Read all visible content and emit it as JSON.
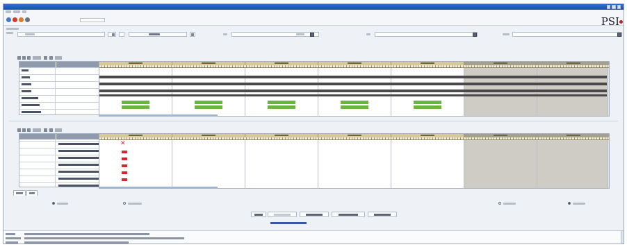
{
  "window": {
    "title": "",
    "accent": "#2f6fd6"
  },
  "menu": {
    "items": [
      "",
      "",
      ""
    ]
  },
  "toolbar": {
    "icons": [
      "save-icon",
      "stop-icon",
      "refresh-icon",
      "settings-icon"
    ],
    "selector_value": "",
    "logo_text": "PSI",
    "logo_dot_color": "#c8201e"
  },
  "filters": {
    "section_label": "",
    "field1_label": "",
    "field1_value": "",
    "field2_value": "",
    "field3_label": "",
    "field3_value": "",
    "field4_label": "",
    "field4_value": "",
    "field5_label": "",
    "field5_value": ""
  },
  "upper_grid": {
    "toolbar_count": "",
    "headers": [
      "",
      ""
    ],
    "rows": [
      "",
      "",
      "",
      "",
      "",
      "",
      ""
    ],
    "days": [
      "",
      "",
      "",
      "",
      "",
      "",
      ""
    ],
    "weekend_days": [
      5,
      6
    ],
    "bar_color_green": "#6db33f",
    "band_color": "#4a4848"
  },
  "lower_grid": {
    "toolbar_count": "",
    "headers": [
      "",
      ""
    ],
    "rows": [
      "",
      "",
      "",
      "",
      "",
      "",
      ""
    ],
    "days": [
      "",
      "",
      "",
      "",
      "",
      "",
      ""
    ],
    "marker_color": "#d8262a"
  },
  "tabs": [
    "",
    ""
  ],
  "options": {
    "left_radio": "",
    "mid_radio": "",
    "right_radio_1": "",
    "right_radio_2": ""
  },
  "actions": {
    "buttons": [
      "",
      "",
      "",
      "",
      ""
    ],
    "footer_link": ""
  },
  "status": {
    "lines": [
      "",
      "",
      ""
    ]
  }
}
